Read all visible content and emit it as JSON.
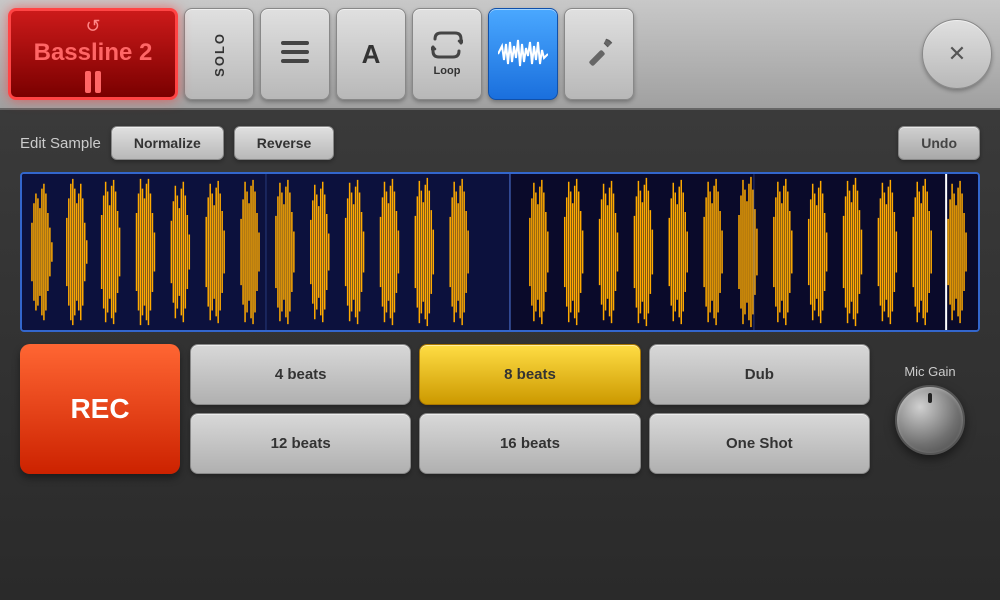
{
  "toolbar": {
    "bassline_icon": "↺",
    "bassline_label": "Bassline 2",
    "solo_label": "SOLO",
    "hamburger_icon": "☰",
    "font_icon": "A",
    "loop_icon": "↺",
    "loop_label": "Loop",
    "waveform_icon": "~",
    "wrench_icon": "🔧",
    "close_icon": "✕"
  },
  "edit_sample": {
    "label": "Edit Sample",
    "normalize_label": "Normalize",
    "reverse_label": "Reverse",
    "undo_label": "Undo"
  },
  "beat_buttons": {
    "b4": "4 beats",
    "b8": "8 beats",
    "dub": "Dub",
    "b12": "12 beats",
    "b16": "16 beats",
    "oneshot": "One Shot"
  },
  "rec_label": "REC",
  "mic_gain_label": "Mic Gain",
  "waveform": {
    "segments": 10,
    "color": "#ffaa00"
  },
  "colors": {
    "active_blue": "#2277ee",
    "active_gold": "#ddbb00",
    "rec_red": "#cc2200",
    "bassline_bg": "#880000"
  }
}
